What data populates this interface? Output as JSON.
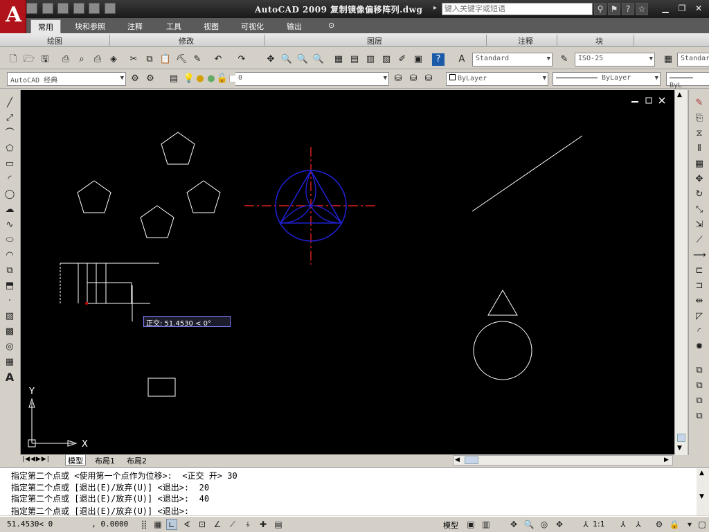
{
  "app": {
    "logo_letter": "A",
    "title": "AutoCAD  2009  复制镜像偏移阵列.dwg",
    "search_placeholder": "键入关键字或短语"
  },
  "ribbon": {
    "tabs": [
      "常用",
      "块和参照",
      "注释",
      "工具",
      "视图",
      "可视化",
      "输出"
    ],
    "panels": [
      "绘图",
      "修改",
      "图层",
      "注释",
      "块"
    ]
  },
  "toolbar1": {
    "text_style": "Standard",
    "dim_style": "ISO-25",
    "table_style": "Standar"
  },
  "toolbar2": {
    "workspace": "AutoCAD 经典",
    "layer": "0",
    "color": "ByLayer",
    "linetype": "ByLayer",
    "lineweight": "ByL"
  },
  "canvas": {
    "tooltip": "正交: 51.4530 < 0°",
    "ucs_x": "X",
    "ucs_y": "Y"
  },
  "layout_tabs": [
    "模型",
    "布局1",
    "布局2"
  ],
  "command": {
    "lines": [
      "指定第二个点或 <使用第一个点作为位移>:  <正交 开> 30",
      "指定第二个点或 [退出(E)/放弃(U)] <退出>:  20",
      "指定第二个点或 [退出(E)/放弃(U)] <退出>:  40",
      "指定第二个点或 [退出(E)/放弃(U)] <退出>:"
    ]
  },
  "status": {
    "coord_x": "51.4530<  0",
    "coord_z": ", 0.0000",
    "model_label": "模型",
    "scale": "1:1"
  }
}
